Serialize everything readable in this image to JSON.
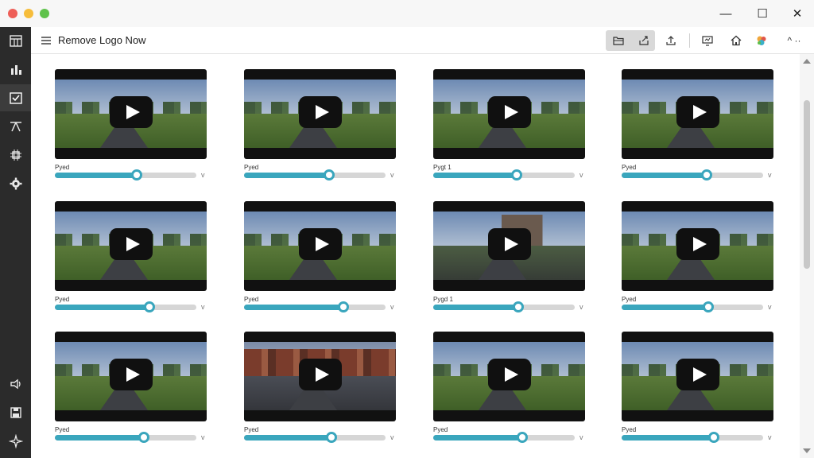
{
  "window": {
    "title": "Remove Logo Now"
  },
  "window_controls": {
    "minimize": "—",
    "maximize": "☐",
    "close": "✕"
  },
  "toolbar": {
    "menu_icon": "hamburger-menu-icon",
    "title": "Remove Logo Now",
    "buttons": [
      "folder-open-icon",
      "export-icon",
      "upload-icon",
      "monitor-icon",
      "home-icon",
      "color-palette-icon"
    ],
    "more_label": "^ ··"
  },
  "sidebar": {
    "items": [
      {
        "icon": "calendar-grid-icon",
        "active": false
      },
      {
        "icon": "chart-icon",
        "active": false
      },
      {
        "icon": "checklist-icon",
        "active": true
      },
      {
        "icon": "crop-icon",
        "active": false
      },
      {
        "icon": "chip-icon",
        "active": false
      },
      {
        "icon": "gear-icon",
        "active": false
      }
    ],
    "bottom_items": [
      {
        "icon": "sound-icon"
      },
      {
        "icon": "save-icon"
      },
      {
        "icon": "sparkle-icon"
      }
    ]
  },
  "colors": {
    "accent": "#3aa6bd",
    "sidebar": "#2b2b2b",
    "track": "#d6d6d6"
  },
  "videos": [
    {
      "label": "Pyed",
      "progress": 0.58,
      "scene": "rural"
    },
    {
      "label": "Pyed",
      "progress": 0.6,
      "scene": "rural"
    },
    {
      "label": "Pygt 1",
      "progress": 0.59,
      "scene": "rural"
    },
    {
      "label": "Pyed",
      "progress": 0.6,
      "scene": "rural"
    },
    {
      "label": "Pyed",
      "progress": 0.67,
      "scene": "rural"
    },
    {
      "label": "Pyed",
      "progress": 0.7,
      "scene": "rural"
    },
    {
      "label": "Pygd 1",
      "progress": 0.6,
      "scene": "robot"
    },
    {
      "label": "Pyed",
      "progress": 0.61,
      "scene": "rural"
    },
    {
      "label": "Pyed",
      "progress": 0.63,
      "scene": "rural"
    },
    {
      "label": "Pyed",
      "progress": 0.62,
      "scene": "urban"
    },
    {
      "label": "Pyed",
      "progress": 0.63,
      "scene": "rural"
    },
    {
      "label": "Pyed",
      "progress": 0.65,
      "scene": "rural"
    }
  ]
}
